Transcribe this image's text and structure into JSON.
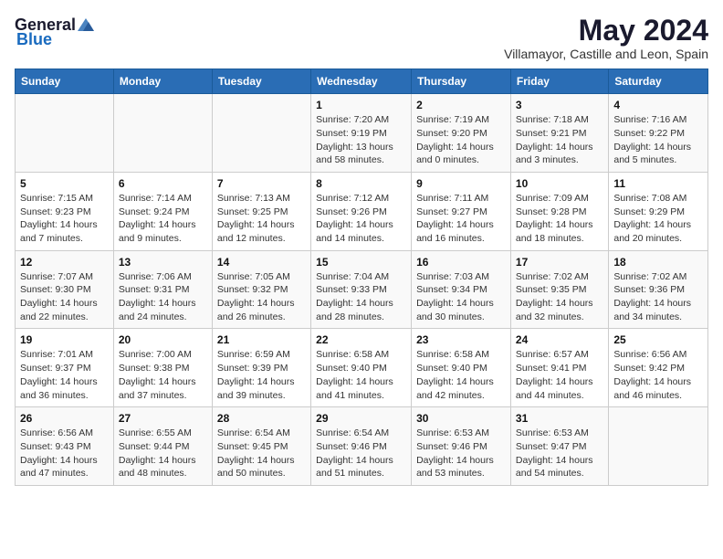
{
  "logo": {
    "general": "General",
    "blue": "Blue"
  },
  "title": "May 2024",
  "subtitle": "Villamayor, Castille and Leon, Spain",
  "days_of_week": [
    "Sunday",
    "Monday",
    "Tuesday",
    "Wednesday",
    "Thursday",
    "Friday",
    "Saturday"
  ],
  "weeks": [
    [
      {
        "day": "",
        "sunrise": "",
        "sunset": "",
        "daylight": ""
      },
      {
        "day": "",
        "sunrise": "",
        "sunset": "",
        "daylight": ""
      },
      {
        "day": "",
        "sunrise": "",
        "sunset": "",
        "daylight": ""
      },
      {
        "day": "1",
        "sunrise": "Sunrise: 7:20 AM",
        "sunset": "Sunset: 9:19 PM",
        "daylight": "Daylight: 13 hours and 58 minutes."
      },
      {
        "day": "2",
        "sunrise": "Sunrise: 7:19 AM",
        "sunset": "Sunset: 9:20 PM",
        "daylight": "Daylight: 14 hours and 0 minutes."
      },
      {
        "day": "3",
        "sunrise": "Sunrise: 7:18 AM",
        "sunset": "Sunset: 9:21 PM",
        "daylight": "Daylight: 14 hours and 3 minutes."
      },
      {
        "day": "4",
        "sunrise": "Sunrise: 7:16 AM",
        "sunset": "Sunset: 9:22 PM",
        "daylight": "Daylight: 14 hours and 5 minutes."
      }
    ],
    [
      {
        "day": "5",
        "sunrise": "Sunrise: 7:15 AM",
        "sunset": "Sunset: 9:23 PM",
        "daylight": "Daylight: 14 hours and 7 minutes."
      },
      {
        "day": "6",
        "sunrise": "Sunrise: 7:14 AM",
        "sunset": "Sunset: 9:24 PM",
        "daylight": "Daylight: 14 hours and 9 minutes."
      },
      {
        "day": "7",
        "sunrise": "Sunrise: 7:13 AM",
        "sunset": "Sunset: 9:25 PM",
        "daylight": "Daylight: 14 hours and 12 minutes."
      },
      {
        "day": "8",
        "sunrise": "Sunrise: 7:12 AM",
        "sunset": "Sunset: 9:26 PM",
        "daylight": "Daylight: 14 hours and 14 minutes."
      },
      {
        "day": "9",
        "sunrise": "Sunrise: 7:11 AM",
        "sunset": "Sunset: 9:27 PM",
        "daylight": "Daylight: 14 hours and 16 minutes."
      },
      {
        "day": "10",
        "sunrise": "Sunrise: 7:09 AM",
        "sunset": "Sunset: 9:28 PM",
        "daylight": "Daylight: 14 hours and 18 minutes."
      },
      {
        "day": "11",
        "sunrise": "Sunrise: 7:08 AM",
        "sunset": "Sunset: 9:29 PM",
        "daylight": "Daylight: 14 hours and 20 minutes."
      }
    ],
    [
      {
        "day": "12",
        "sunrise": "Sunrise: 7:07 AM",
        "sunset": "Sunset: 9:30 PM",
        "daylight": "Daylight: 14 hours and 22 minutes."
      },
      {
        "day": "13",
        "sunrise": "Sunrise: 7:06 AM",
        "sunset": "Sunset: 9:31 PM",
        "daylight": "Daylight: 14 hours and 24 minutes."
      },
      {
        "day": "14",
        "sunrise": "Sunrise: 7:05 AM",
        "sunset": "Sunset: 9:32 PM",
        "daylight": "Daylight: 14 hours and 26 minutes."
      },
      {
        "day": "15",
        "sunrise": "Sunrise: 7:04 AM",
        "sunset": "Sunset: 9:33 PM",
        "daylight": "Daylight: 14 hours and 28 minutes."
      },
      {
        "day": "16",
        "sunrise": "Sunrise: 7:03 AM",
        "sunset": "Sunset: 9:34 PM",
        "daylight": "Daylight: 14 hours and 30 minutes."
      },
      {
        "day": "17",
        "sunrise": "Sunrise: 7:02 AM",
        "sunset": "Sunset: 9:35 PM",
        "daylight": "Daylight: 14 hours and 32 minutes."
      },
      {
        "day": "18",
        "sunrise": "Sunrise: 7:02 AM",
        "sunset": "Sunset: 9:36 PM",
        "daylight": "Daylight: 14 hours and 34 minutes."
      }
    ],
    [
      {
        "day": "19",
        "sunrise": "Sunrise: 7:01 AM",
        "sunset": "Sunset: 9:37 PM",
        "daylight": "Daylight: 14 hours and 36 minutes."
      },
      {
        "day": "20",
        "sunrise": "Sunrise: 7:00 AM",
        "sunset": "Sunset: 9:38 PM",
        "daylight": "Daylight: 14 hours and 37 minutes."
      },
      {
        "day": "21",
        "sunrise": "Sunrise: 6:59 AM",
        "sunset": "Sunset: 9:39 PM",
        "daylight": "Daylight: 14 hours and 39 minutes."
      },
      {
        "day": "22",
        "sunrise": "Sunrise: 6:58 AM",
        "sunset": "Sunset: 9:40 PM",
        "daylight": "Daylight: 14 hours and 41 minutes."
      },
      {
        "day": "23",
        "sunrise": "Sunrise: 6:58 AM",
        "sunset": "Sunset: 9:40 PM",
        "daylight": "Daylight: 14 hours and 42 minutes."
      },
      {
        "day": "24",
        "sunrise": "Sunrise: 6:57 AM",
        "sunset": "Sunset: 9:41 PM",
        "daylight": "Daylight: 14 hours and 44 minutes."
      },
      {
        "day": "25",
        "sunrise": "Sunrise: 6:56 AM",
        "sunset": "Sunset: 9:42 PM",
        "daylight": "Daylight: 14 hours and 46 minutes."
      }
    ],
    [
      {
        "day": "26",
        "sunrise": "Sunrise: 6:56 AM",
        "sunset": "Sunset: 9:43 PM",
        "daylight": "Daylight: 14 hours and 47 minutes."
      },
      {
        "day": "27",
        "sunrise": "Sunrise: 6:55 AM",
        "sunset": "Sunset: 9:44 PM",
        "daylight": "Daylight: 14 hours and 48 minutes."
      },
      {
        "day": "28",
        "sunrise": "Sunrise: 6:54 AM",
        "sunset": "Sunset: 9:45 PM",
        "daylight": "Daylight: 14 hours and 50 minutes."
      },
      {
        "day": "29",
        "sunrise": "Sunrise: 6:54 AM",
        "sunset": "Sunset: 9:46 PM",
        "daylight": "Daylight: 14 hours and 51 minutes."
      },
      {
        "day": "30",
        "sunrise": "Sunrise: 6:53 AM",
        "sunset": "Sunset: 9:46 PM",
        "daylight": "Daylight: 14 hours and 53 minutes."
      },
      {
        "day": "31",
        "sunrise": "Sunrise: 6:53 AM",
        "sunset": "Sunset: 9:47 PM",
        "daylight": "Daylight: 14 hours and 54 minutes."
      },
      {
        "day": "",
        "sunrise": "",
        "sunset": "",
        "daylight": ""
      }
    ]
  ]
}
